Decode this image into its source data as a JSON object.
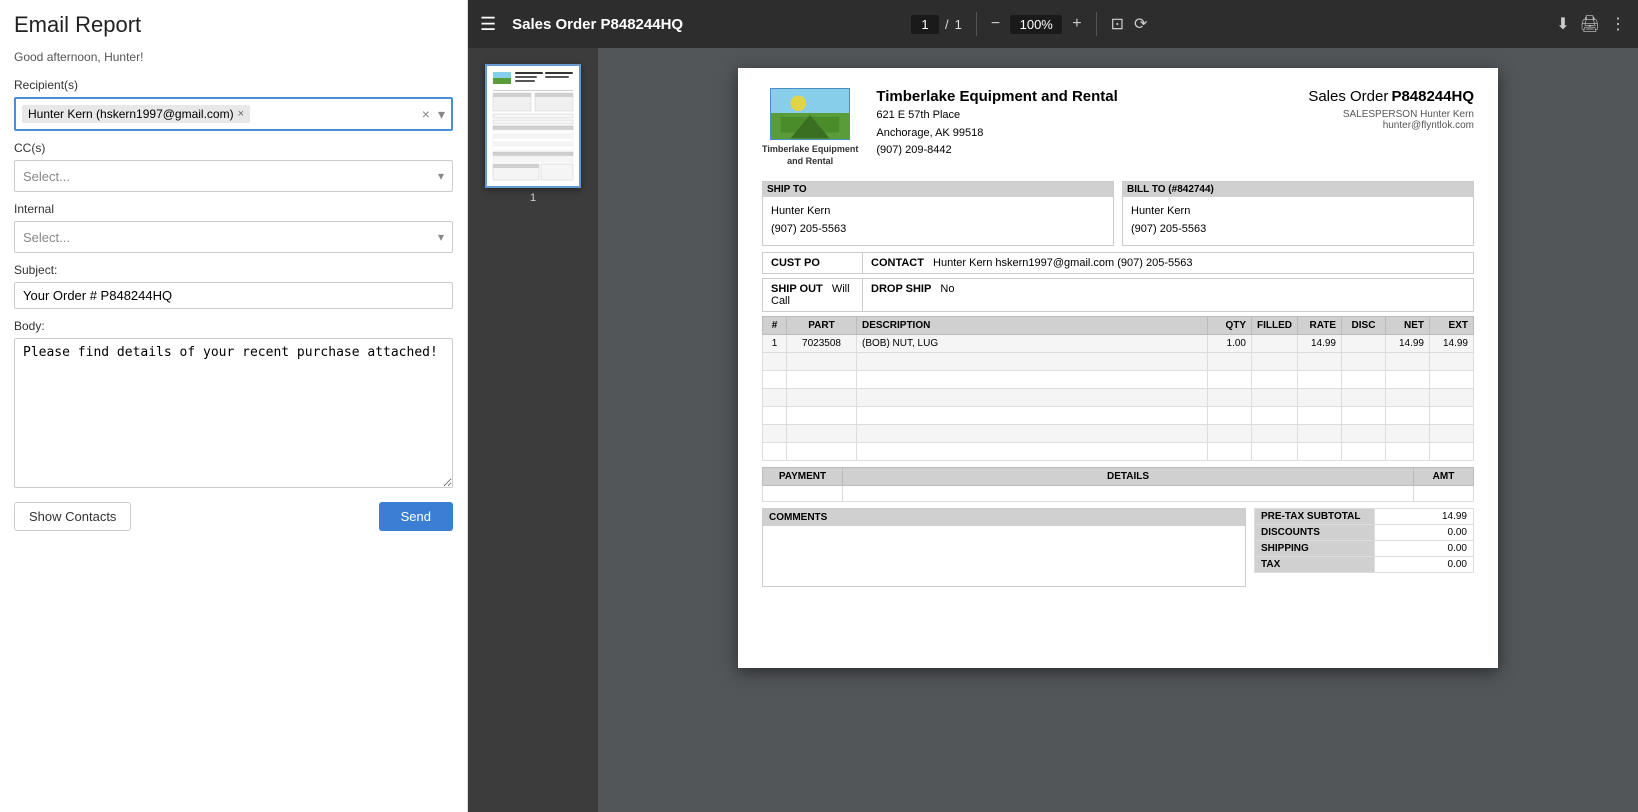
{
  "page_title": "Email Report",
  "greeting": "Good afternoon, Hunter!",
  "form": {
    "recipients_label": "Recipient(s)",
    "recipient_tag": "Hunter Kern (hskern1997@gmail.com)",
    "cc_label": "CC(s)",
    "cc_placeholder": "Select...",
    "internal_label": "Internal",
    "internal_placeholder": "Select...",
    "subject_label": "Subject:",
    "subject_value": "Your Order # P848244HQ",
    "body_label": "Body:",
    "body_value": "Please find details of your recent purchase attached!",
    "show_contacts_label": "Show Contacts",
    "send_label": "Send"
  },
  "pdf": {
    "title": "Sales Order P848244HQ",
    "page_current": "1",
    "page_total": "1",
    "zoom": "100%",
    "company_name": "Timberlake Equipment and Rental",
    "company_address_line1": "621 E 57th Place",
    "company_address_line2": "Anchorage, AK 99518",
    "company_phone": "(907) 209-8442",
    "logo_text_line1": "Timberlake Equipment",
    "logo_text_line2": "and Rental",
    "sales_order_label": "Sales Order",
    "sales_order_number": "P848244HQ",
    "salesperson_label": "SALESPERSON",
    "salesperson_name": "Hunter Kern",
    "salesperson_email": "hunter@flyntlok.com",
    "ship_to_header": "SHIP TO",
    "ship_to_name": "Hunter Kern",
    "ship_to_phone": "(907) 205-5563",
    "bill_to_header": "BILL TO (#842744)",
    "bill_to_name": "Hunter Kern",
    "bill_to_phone": "(907) 205-5563",
    "cust_po_label": "CUST PO",
    "contact_label": "CONTACT",
    "contact_value": "Hunter Kern  hskern1997@gmail.com  (907) 205-5563",
    "ship_out_label": "SHIP OUT",
    "ship_out_value": "Will Call",
    "drop_ship_label": "DROP SHIP",
    "drop_ship_value": "No",
    "table_headers": [
      "#",
      "PART",
      "DESCRIPTION",
      "QTY",
      "FILLED",
      "RATE",
      "DISC",
      "NET",
      "EXT"
    ],
    "table_rows": [
      {
        "num": "1",
        "part": "7023508",
        "desc": "(BOB) NUT, LUG",
        "qty": "1.00",
        "filled": "",
        "rate": "14.99",
        "disc": "",
        "net": "14.99",
        "ext": "14.99"
      }
    ],
    "payment_headers": [
      "PAYMENT",
      "DETAILS",
      "AMT"
    ],
    "comments_label": "COMMENTS",
    "totals": [
      {
        "label": "PRE-TAX SUBTOTAL",
        "value": "14.99"
      },
      {
        "label": "DISCOUNTS",
        "value": "0.00"
      },
      {
        "label": "SHIPPING",
        "value": "0.00"
      },
      {
        "label": "TAX",
        "value": "0.00"
      }
    ]
  },
  "icons": {
    "menu": "☰",
    "minus": "−",
    "plus": "+",
    "fit_page": "⊡",
    "history": "⟳",
    "download": "⬇",
    "print": "🖨",
    "more": "⋮",
    "chevron_down": "▾",
    "close_x": "×"
  }
}
